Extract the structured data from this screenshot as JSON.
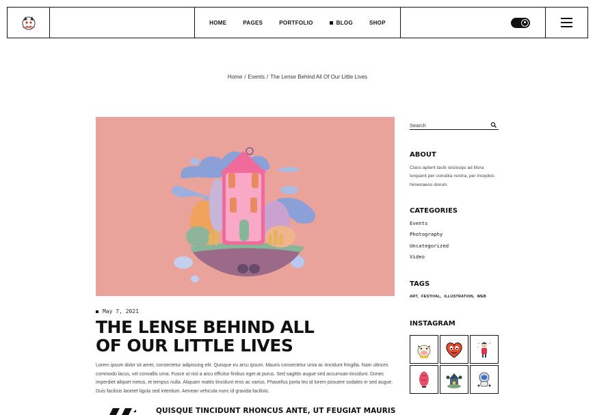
{
  "header": {
    "nav": [
      {
        "label": "HOME",
        "active": false
      },
      {
        "label": "PAGES",
        "active": false
      },
      {
        "label": "PORTFOLIO",
        "active": false
      },
      {
        "label": "BLOG",
        "active": true
      },
      {
        "label": "SHOP",
        "active": false
      }
    ]
  },
  "breadcrumb": {
    "items": [
      "Home",
      "Events",
      "The Lense Behind All Of Our Little Lives"
    ],
    "separator": "/"
  },
  "post": {
    "date": "May 7, 2021",
    "title": "THE LENSE BEHIND ALL OF OUR LITTLE LIVES",
    "body": "Lorem ipsum dolor sit amet, consectetur adipiscing elit. Quisque eu arcu ipsum. Mauris consectetur urna ac tincidunt fringilla. Nam ultrices commodo lacus, vel convallis urna. Fusce ut nisl a arcu efficitur finibus eget at purus. Sed sagittis augue sed accumsan tincidunt. Donec imperdiet aliquet metus, et tempus nulla. Aliquam mattis tincidunt eros ac varius. Phasellus porta leo id lorem posuere sodales in sed augue. Duis facilisis laoreet ligula sed interdum. Aenean vehicula nunc id gravida facilisis.",
    "subheading": "QUISQUE TINCIDUNT RHONCUS ANTE, UT FEUGIAT MAURIS",
    "hero_bg": "#e9a39a"
  },
  "sidebar": {
    "search_placeholder": "Search",
    "about_heading": "ABOUT",
    "about_text": "Class aptent taciti sociosqu ad litora torquent per conubia nostra, per inceptos himenaeos dorum.",
    "categories_heading": "CATEGORIES",
    "categories": [
      "Events",
      "Photography",
      "Uncategorized",
      "Video"
    ],
    "tags_heading": "TAGS",
    "tags": [
      "ART,",
      "FESTIVAL,",
      "ILLUSTRATION,",
      "WEB"
    ],
    "instagram_heading": "INSTAGRAM",
    "instagram_icons": [
      "cow-figure-icon",
      "heart-character-icon",
      "girl-figure-icon",
      "pink-creature-icon",
      "house-figure-icon",
      "astronaut-figure-icon"
    ]
  }
}
